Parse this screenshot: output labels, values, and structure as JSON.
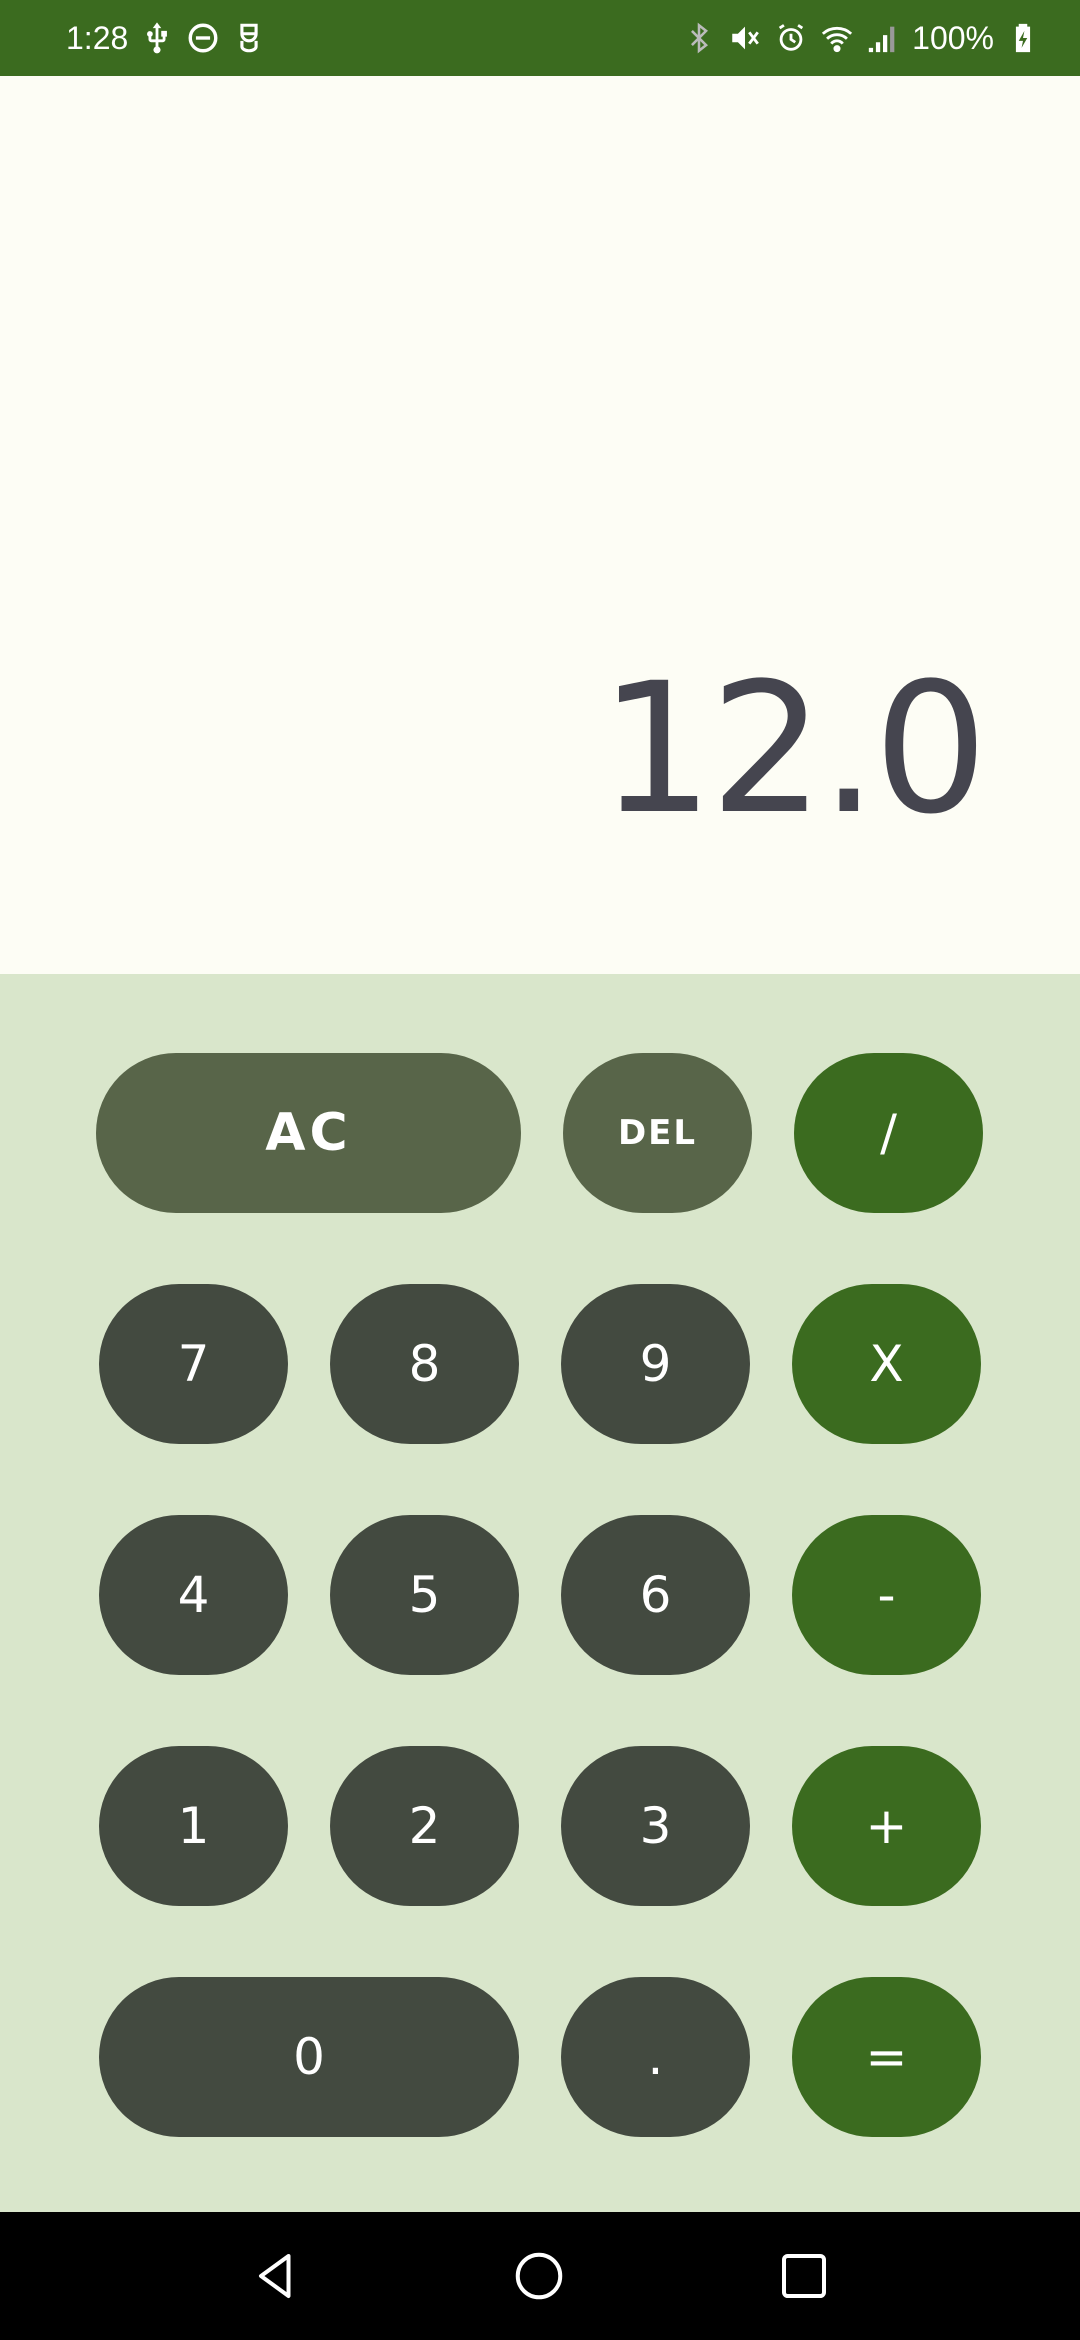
{
  "status_bar": {
    "time": "1:28",
    "battery": "100%",
    "icons_left": [
      "usb-icon",
      "do-not-disturb-icon",
      "notification-icon"
    ],
    "icons_right": [
      "bluetooth-icon",
      "vibrate-mute-icon",
      "alarm-icon",
      "wifi-icon",
      "signal-icon",
      "battery-charging-icon"
    ],
    "color": "#3b6b1f"
  },
  "display": {
    "result": "12.0"
  },
  "keypad": {
    "ac": "AC",
    "del": "DEL",
    "divide": "/",
    "multiply": "X",
    "subtract": "-",
    "add": "+",
    "equals": "=",
    "dot": ".",
    "digits": [
      "0",
      "1",
      "2",
      "3",
      "4",
      "5",
      "6",
      "7",
      "8",
      "9"
    ],
    "colors": {
      "background": "#d9e6cb",
      "digit": "#434a40",
      "function": "#586549",
      "operator": "#3b6b1f"
    }
  },
  "nav_bar": {
    "icons": [
      "back-icon",
      "home-icon",
      "recents-icon"
    ]
  }
}
